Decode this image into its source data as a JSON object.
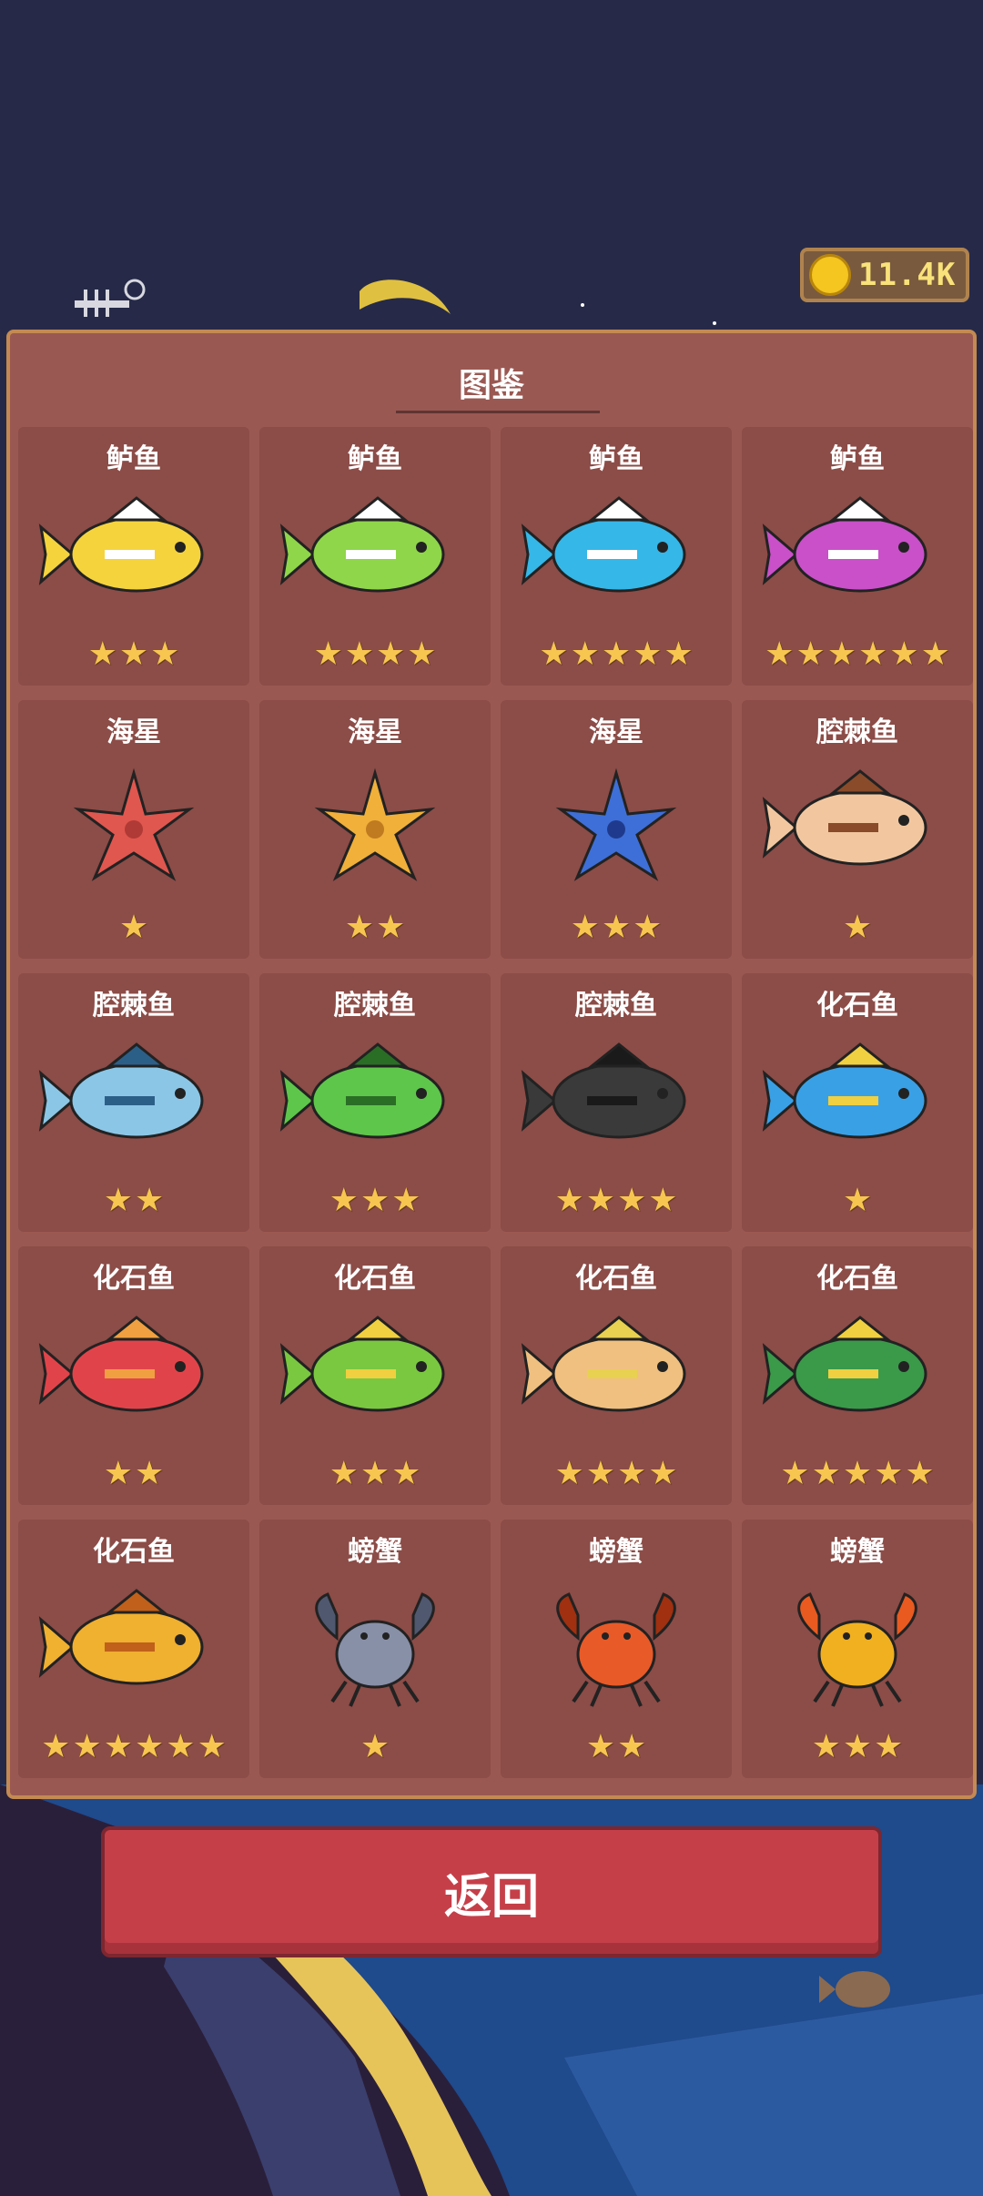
{
  "currency": {
    "amount": "11.4K",
    "icon": "coin-icon"
  },
  "collection": {
    "title": "图鉴",
    "cards": [
      {
        "name": "鲈鱼",
        "stars": 3,
        "creature": "fish",
        "colors": [
          "#f5d33d",
          "#ffffff"
        ]
      },
      {
        "name": "鲈鱼",
        "stars": 4,
        "creature": "fish",
        "colors": [
          "#8fd64a",
          "#ffffff"
        ]
      },
      {
        "name": "鲈鱼",
        "stars": 5,
        "creature": "fish",
        "colors": [
          "#35b7e8",
          "#ffffff"
        ]
      },
      {
        "name": "鲈鱼",
        "stars": 6,
        "creature": "fish",
        "colors": [
          "#c950c9",
          "#ffffff"
        ]
      },
      {
        "name": "海星",
        "stars": 1,
        "creature": "starfish",
        "colors": [
          "#e0574f",
          "#b03a35"
        ]
      },
      {
        "name": "海星",
        "stars": 2,
        "creature": "starfish",
        "colors": [
          "#f0b03a",
          "#c07a20"
        ]
      },
      {
        "name": "海星",
        "stars": 3,
        "creature": "starfish",
        "colors": [
          "#3e6fd8",
          "#1f3a8c"
        ]
      },
      {
        "name": "腔棘鱼",
        "stars": 1,
        "creature": "fish",
        "colors": [
          "#f2c7a0",
          "#8a4b2a"
        ]
      },
      {
        "name": "腔棘鱼",
        "stars": 2,
        "creature": "fish",
        "colors": [
          "#8cc6e6",
          "#2c5f88"
        ]
      },
      {
        "name": "腔棘鱼",
        "stars": 3,
        "creature": "fish",
        "colors": [
          "#5ec64a",
          "#2a6e26"
        ]
      },
      {
        "name": "腔棘鱼",
        "stars": 4,
        "creature": "fish",
        "colors": [
          "#3a3a3a",
          "#1a1a1a"
        ]
      },
      {
        "name": "化石鱼",
        "stars": 1,
        "creature": "fish",
        "colors": [
          "#3aa0e6",
          "#f0d040"
        ]
      },
      {
        "name": "化石鱼",
        "stars": 2,
        "creature": "fish",
        "colors": [
          "#e0444a",
          "#f0a040"
        ]
      },
      {
        "name": "化石鱼",
        "stars": 3,
        "creature": "fish",
        "colors": [
          "#7ac840",
          "#f0d040"
        ]
      },
      {
        "name": "化石鱼",
        "stars": 4,
        "creature": "fish",
        "colors": [
          "#f0c080",
          "#e8d050"
        ]
      },
      {
        "name": "化石鱼",
        "stars": 5,
        "creature": "fish",
        "colors": [
          "#3a9a4a",
          "#f0d040"
        ]
      },
      {
        "name": "化石鱼",
        "stars": 6,
        "creature": "fish",
        "colors": [
          "#f0b030",
          "#c0601a"
        ]
      },
      {
        "name": "螃蟹",
        "stars": 1,
        "creature": "crab",
        "colors": [
          "#8890a8",
          "#505870"
        ]
      },
      {
        "name": "螃蟹",
        "stars": 2,
        "creature": "crab",
        "colors": [
          "#e85a28",
          "#a03010"
        ]
      },
      {
        "name": "螃蟹",
        "stars": 3,
        "creature": "crab",
        "colors": [
          "#f0b020",
          "#e85a20"
        ]
      }
    ]
  },
  "back_button": {
    "label": "返回"
  }
}
